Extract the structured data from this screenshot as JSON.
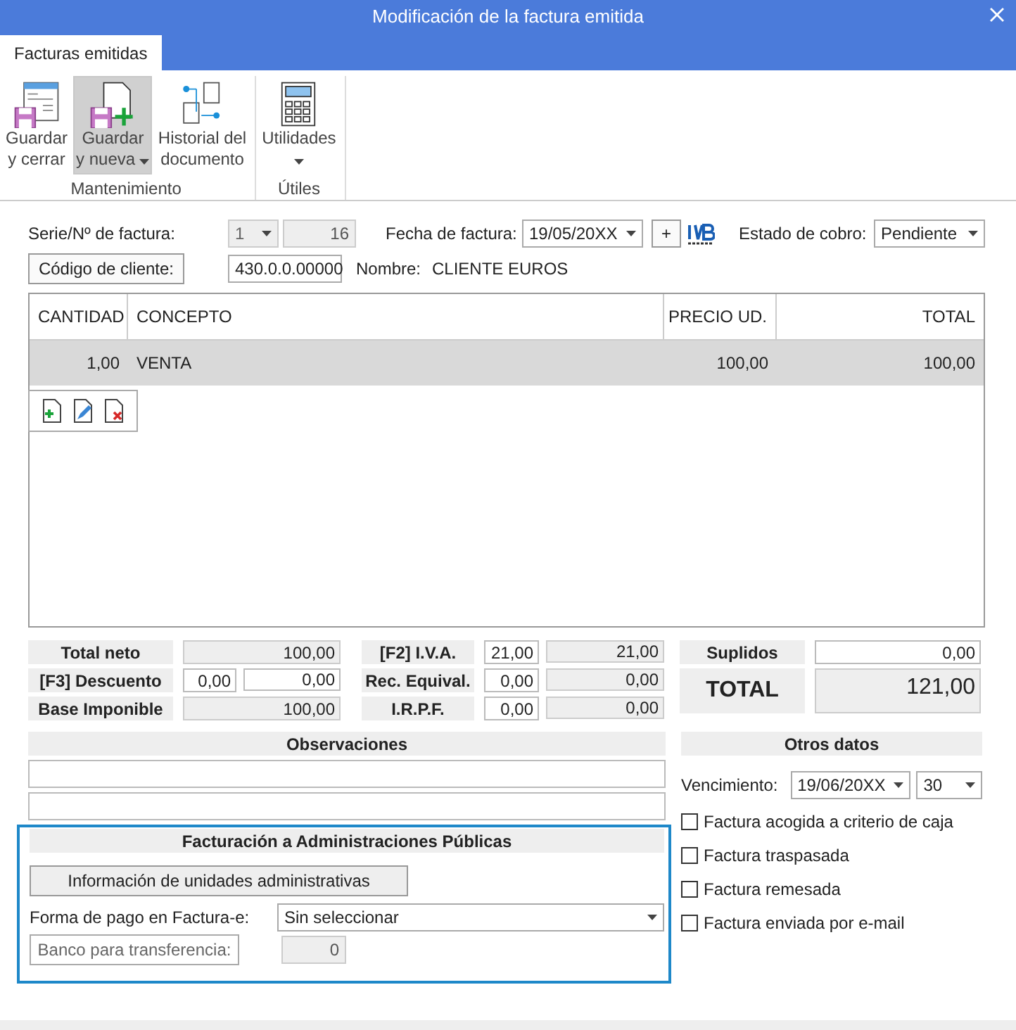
{
  "window": {
    "title": "Modificación de la factura emitida"
  },
  "tabs": [
    {
      "label": "Facturas emitidas",
      "selected": true
    }
  ],
  "ribbon": {
    "groups": [
      {
        "label": "Mantenimiento",
        "buttons": [
          {
            "kind": "save-close",
            "lines": [
              "Guardar",
              "y cerrar"
            ],
            "dropdown": false,
            "selected": false
          },
          {
            "kind": "save-new",
            "lines": [
              "Guardar",
              "y nueva"
            ],
            "dropdown": true,
            "selected": true
          },
          {
            "kind": "history",
            "lines": [
              "Historial del",
              "documento"
            ],
            "dropdown": false,
            "selected": false
          }
        ]
      },
      {
        "label": "Útiles",
        "buttons": [
          {
            "kind": "calculator",
            "lines": [
              "Utilidades"
            ],
            "dropdown": true,
            "selected": false
          }
        ]
      }
    ]
  },
  "header": {
    "serie_label": "Serie/Nº de factura:",
    "serie": {
      "value": "1",
      "disabled": true
    },
    "numero": {
      "value": "16",
      "disabled": true
    },
    "fecha_label": "Fecha de factura:",
    "fecha": "19/05/20XX",
    "plus": "+",
    "estado_label": "Estado de cobro:",
    "estado": "Pendiente",
    "cliente_button": "Código de cliente:",
    "cliente_code": "430.0.0.00000",
    "nombre_label": "Nombre:",
    "nombre": "CLIENTE EUROS"
  },
  "grid": {
    "columns": [
      "CANTIDAD",
      "CONCEPTO",
      "PRECIO UD.",
      "TOTAL"
    ],
    "rows": [
      {
        "cells": [
          "1,00",
          "VENTA",
          "100,00",
          "100,00"
        ],
        "selected": true
      }
    ]
  },
  "totals": {
    "left": [
      {
        "label": "Total neto",
        "values": [
          {
            "kind": "readonly",
            "text": "100,00"
          }
        ]
      },
      {
        "label": "[F3] Descuento",
        "values": [
          {
            "kind": "input",
            "text": "0,00"
          },
          {
            "kind": "input",
            "text": "0,00"
          }
        ]
      },
      {
        "label": "Base Imponible",
        "values": [
          {
            "kind": "readonly",
            "text": "100,00"
          }
        ]
      }
    ],
    "middle": [
      {
        "label": "[F2] I.V.A.",
        "values": [
          {
            "kind": "input",
            "text": "21,00"
          },
          {
            "kind": "readonly",
            "text": "21,00"
          }
        ]
      },
      {
        "label": "Rec. Equival.",
        "values": [
          {
            "kind": "input",
            "text": "0,00"
          },
          {
            "kind": "readonly",
            "text": "0,00"
          }
        ]
      },
      {
        "label": "I.R.P.F.",
        "values": [
          {
            "kind": "input",
            "text": "0,00"
          },
          {
            "kind": "readonly",
            "text": "0,00"
          }
        ]
      }
    ],
    "suplidos": {
      "label": "Suplidos",
      "value": "0,00"
    },
    "total": {
      "label": "TOTAL",
      "value": "121,00"
    }
  },
  "observaciones": {
    "title": "Observaciones"
  },
  "administraciones": {
    "title": "Facturación a Administraciones Públicas",
    "info_button": "Información de unidades administrativas",
    "forma_label": "Forma de pago en Factura-e:",
    "forma": "Sin seleccionar",
    "banco_button": {
      "label": "Banco para transferencia:",
      "disabled": true
    },
    "banco": {
      "value": "0",
      "disabled": true
    }
  },
  "otros": {
    "title": "Otros datos",
    "vencimiento_label": "Vencimiento:",
    "vencimiento": "19/06/20XX",
    "dias": "30",
    "checks": [
      {
        "label": "Factura acogida a criterio de caja",
        "checked": false
      },
      {
        "label": "Factura traspasada",
        "checked": false
      },
      {
        "label": "Factura remesada",
        "checked": false
      },
      {
        "label": "Factura enviada por e-mail",
        "checked": false
      }
    ]
  }
}
